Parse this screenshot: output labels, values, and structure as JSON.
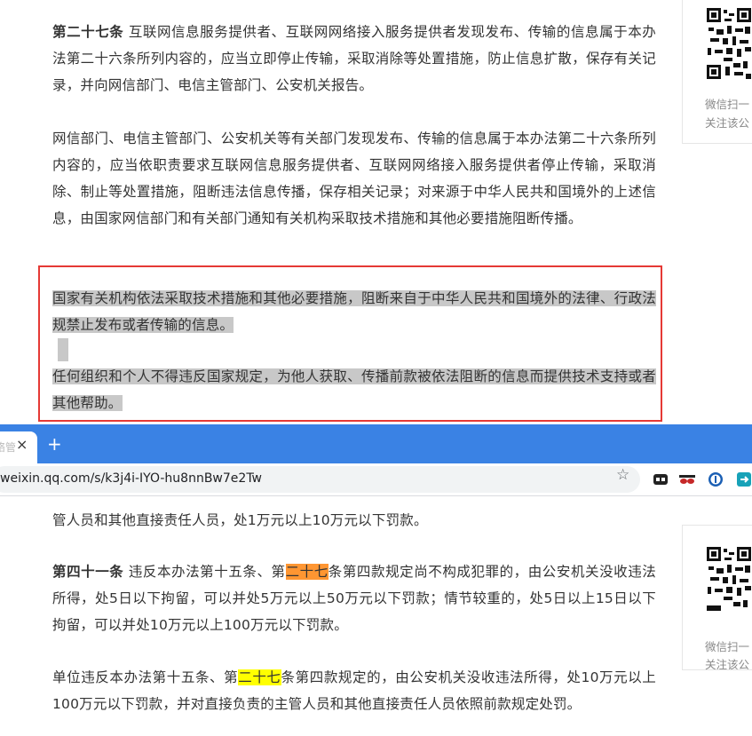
{
  "article": {
    "p1_head": "第二十七条",
    "p1_body": "互联网信息服务提供者、互联网网络接入服务提供者发现发布、传输的信息属于本办法第二十六条所列内容的，应当立即停止传输，采取消除等处置措施，防止信息扩散，保存有关记录，并向网信部门、电信主管部门、公安机关报告。",
    "p2": "网信部门、电信主管部门、公安机关等有关部门发现发布、传输的信息属于本办法第二十六条所列内容的，应当依职责要求互联网信息服务提供者、互联网网络接入服务提供者停止传输，采取消除、制止等处置措施，阻断违法信息传播，保存相关记录；对来源于中华人民共和国境外的上述信息，由国家网信部门和有关部门通知有关机构采取技术措施和其他必要措施阻断传播。",
    "p3": "国家有关机构依法采取技术措施和其他必要措施，阻断来自于中华人民共和国境外的法律、行政法规禁止发布或者传输的信息。",
    "p4": "任何组织和个人不得违反国家规定，为他人获取、传播前款被依法阻断的信息而提供技术支持或者其他帮助。",
    "p5_partial": "管人员和其他直接责任人员，处1万元以上10万元以下罚款。",
    "p6_head": "第四十一条",
    "p6_a": "违反本办法第十五条、第",
    "p6_mark": "二十七",
    "p6_b": "条第四款规定尚不构成犯罪的，由公安机关没收违法所得，处5日以下拘留，可以并处5万元以上50万元以下罚款；情节较重的，处5日以上15日以下拘留，可以并处10万元以上100万元以下罚款。",
    "p7_a": "单位违反本办法第十五条、第",
    "p7_mark": "二十七",
    "p7_b": "条第四款规定的，由公安机关没收违法所得，处10万元以上100万元以下罚款，并对直接负责的主管人员和其他直接责任人员依照前款规定处罚。"
  },
  "qr_top": {
    "line1": "微信扫一",
    "line2": "关注该公"
  },
  "qr_bottom": {
    "line1": "微信扫一",
    "line2": "关注该公"
  },
  "browser": {
    "tab_title": "络管",
    "tab_close": "×",
    "new_tab": "+",
    "url": "weixin.qq.com/s/k3j4i-IYO-hu8nnBw7e2Tw"
  },
  "colors": {
    "tabbar": "#3a82e4",
    "selection": "#c8c8c8",
    "find_current": "#ff9632",
    "find_match": "#ffff00",
    "annotation_box": "#e53935"
  }
}
